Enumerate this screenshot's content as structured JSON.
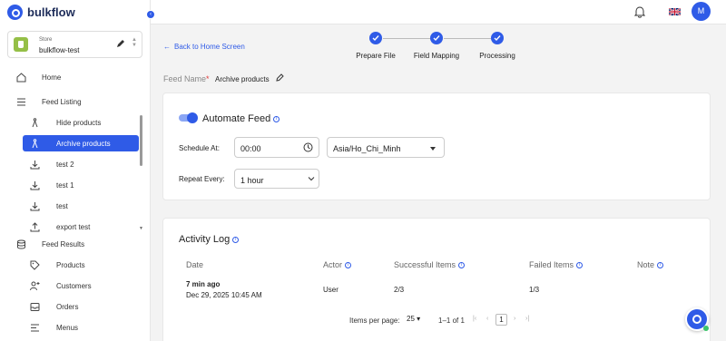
{
  "app": {
    "brand": "bulkflow"
  },
  "store": {
    "label": "Store",
    "name": "bulkflow-test"
  },
  "sidebar": {
    "home": "Home",
    "feed_listing": "Feed Listing",
    "listing_items": [
      {
        "label": "Hide products",
        "icon": "person-walking-icon"
      },
      {
        "label": "Archive products",
        "icon": "person-walking-icon",
        "active": true
      },
      {
        "label": "test 2",
        "icon": "download-icon"
      },
      {
        "label": "test 1",
        "icon": "download-icon"
      },
      {
        "label": "test",
        "icon": "download-icon"
      },
      {
        "label": "export test",
        "icon": "upload-icon"
      }
    ],
    "feed_results": "Feed Results",
    "result_items": [
      "Products",
      "Customers",
      "Orders",
      "Menus"
    ]
  },
  "header": {
    "avatar_initial": "M"
  },
  "back_link": "Back to Home Screen",
  "stepper": {
    "steps": [
      "Prepare File",
      "Field Mapping",
      "Processing"
    ]
  },
  "feed": {
    "label": "Feed Name",
    "required_mark": "*",
    "name": "Archive products"
  },
  "automate": {
    "title": "Automate Feed",
    "schedule_label": "Schedule At:",
    "time": "00:00",
    "timezone": "Asia/Ho_Chi_Minh",
    "repeat_label": "Repeat Every:",
    "repeat_value": "1 hour",
    "enabled": true
  },
  "activity": {
    "title": "Activity Log",
    "columns": [
      "Date",
      "Actor",
      "Successful Items",
      "Failed Items",
      "Note"
    ],
    "rows": [
      {
        "relative": "7 min ago",
        "date": "Dec 29, 2025 10:45 AM",
        "actor": "User",
        "successful": "2/3",
        "failed": "1/3",
        "note": ""
      }
    ],
    "pagination": {
      "label": "Items per page:",
      "per_page": "25",
      "range": "1–1 of 1",
      "page": "1"
    }
  },
  "colors": {
    "accent": "#2f5be7",
    "required": "#e03a3a",
    "shopify": "#95bf47"
  }
}
